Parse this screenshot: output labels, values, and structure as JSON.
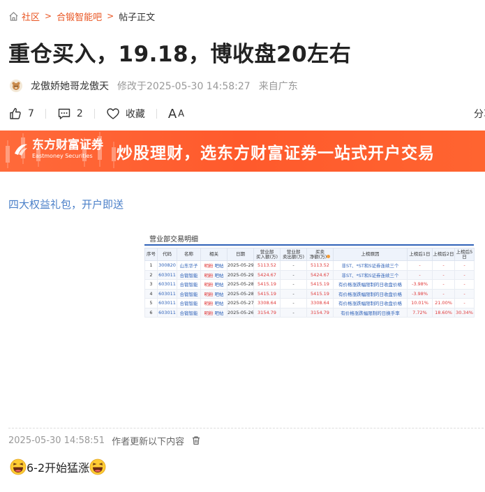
{
  "breadcrumb": {
    "home_icon": "home-icon",
    "items": [
      "社区",
      "合锻智能吧",
      "帖子正文"
    ],
    "separator": ">"
  },
  "post": {
    "title": "重仓买入，19.18，博收盘20左右",
    "author": "龙傲娇她哥龙傲天",
    "modified": "修改于2025-05-30 14:58:27",
    "location": "来自广东"
  },
  "actions": {
    "like_count": "7",
    "comment_count": "2",
    "collect_label": "收藏",
    "font_label_big": "A",
    "font_label_small": "A",
    "share_label": "分享"
  },
  "banner": {
    "logo_cn": "东方财富证券",
    "logo_en": "Eastmoney Securities",
    "slogan": "炒股理财，选东方财富证券一站式开户交易",
    "bg_color": "#ff5a2c"
  },
  "promo_link": "四大权益礼包，开户即送",
  "screenshot": {
    "caption": "营业部交易明细",
    "headers": [
      "序号",
      "代码",
      "名称",
      "相关",
      "日期",
      "营业部\n买入额(万)",
      "营业部\n卖出额(万)",
      "买卖\n净额(万)",
      "上榜原因",
      "上榜后1日",
      "上榜后2日",
      "上榜后5日"
    ],
    "rows": [
      [
        "1",
        "300820",
        "山东华子",
        "明粉 吧帖",
        "2025-05-29",
        "5113.52",
        "-",
        "5113.52",
        "非ST、*ST和S证券连续三个",
        "-",
        "-",
        "-"
      ],
      [
        "2",
        "603011",
        "合锻智能",
        "明粉 吧帖",
        "2025-05-29",
        "5424.67",
        "-",
        "5424.67",
        "非ST、*ST和S证券连续三个",
        "-",
        "-",
        "-"
      ],
      [
        "3",
        "603011",
        "合锻智能",
        "明粉 吧帖",
        "2025-05-28",
        "5415.19",
        "-",
        "5415.19",
        "有价格涨跌幅限制的日收盘价格",
        "-3.98%",
        "-",
        "-"
      ],
      [
        "4",
        "603011",
        "合锻智能",
        "明粉 吧帖",
        "2025-05-28",
        "5415.19",
        "-",
        "5415.19",
        "有价格涨跌幅限制的日收盘价格",
        "-3.98%",
        "-",
        "-"
      ],
      [
        "5",
        "603011",
        "合锻智能",
        "明粉 吧帖",
        "2025-05-27",
        "3308.64",
        "-",
        "3308.64",
        "有价格涨跌幅限制的日收盘价格",
        "10.01%",
        "21.00%",
        "-"
      ],
      [
        "6",
        "603011",
        "合锻智能",
        "明粉 吧帖",
        "2025-05-26",
        "3154.79",
        "-",
        "3154.79",
        "有价格涨跌幅限制的日换手率",
        "7.72%",
        "18.60%",
        "30.34%"
      ]
    ]
  },
  "update": {
    "timestamp": "2025-05-30 14:58:51",
    "note": "作者更新以下内容"
  },
  "comment": {
    "text": "6-2开始猛涨",
    "emoji": "laughing-emoji"
  }
}
